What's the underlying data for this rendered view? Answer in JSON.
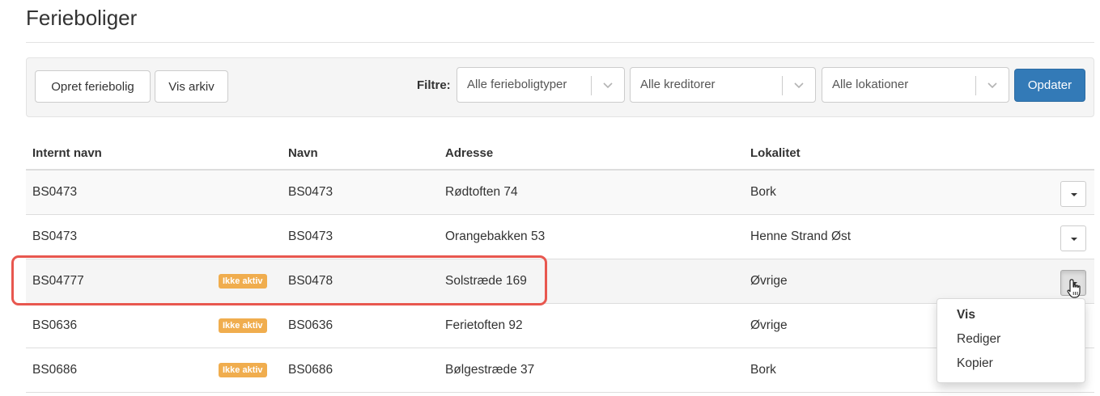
{
  "page": {
    "title": "Ferieboliger"
  },
  "toolbar": {
    "create_label": "Opret feriebolig",
    "archive_label": "Vis arkiv",
    "filter_label": "Filtre:",
    "filters": [
      {
        "value": "Alle ferieboligtyper"
      },
      {
        "value": "Alle kreditorer"
      },
      {
        "value": "Alle lokationer"
      }
    ],
    "update_label": "Opdater"
  },
  "table": {
    "headers": {
      "internal_name": "Internt navn",
      "name": "Navn",
      "address": "Adresse",
      "locality": "Lokalitet"
    },
    "rows": [
      {
        "internal_name": "BS0473",
        "badge": "",
        "name": "BS0473",
        "address": "Rødtoften 74",
        "locality": "Bork"
      },
      {
        "internal_name": "BS0473",
        "badge": "",
        "name": "BS0473",
        "address": "Orangebakken 53",
        "locality": "Henne Strand Øst"
      },
      {
        "internal_name": "BS04777",
        "badge": "Ikke aktiv",
        "name": "BS0478",
        "address": "Solstræde 169",
        "locality": "Øvrige"
      },
      {
        "internal_name": "BS0636",
        "badge": "Ikke aktiv",
        "name": "BS0636",
        "address": "Ferietoften 92",
        "locality": "Øvrige"
      },
      {
        "internal_name": "BS0686",
        "badge": "Ikke aktiv",
        "name": "BS0686",
        "address": "Bølgestræde 37",
        "locality": "Bork"
      }
    ]
  },
  "dropdown_menu": {
    "items": [
      {
        "label": "Vis"
      },
      {
        "label": "Rediger"
      },
      {
        "label": "Kopier"
      }
    ]
  },
  "colors": {
    "primary": "#337ab7",
    "badge": "#f0ad4e",
    "highlight": "#e8574f"
  },
  "icons": {
    "select_arrow": "chevron-down-icon",
    "row_menu": "caret-down-icon",
    "pointer": "hand-pointer-icon"
  }
}
